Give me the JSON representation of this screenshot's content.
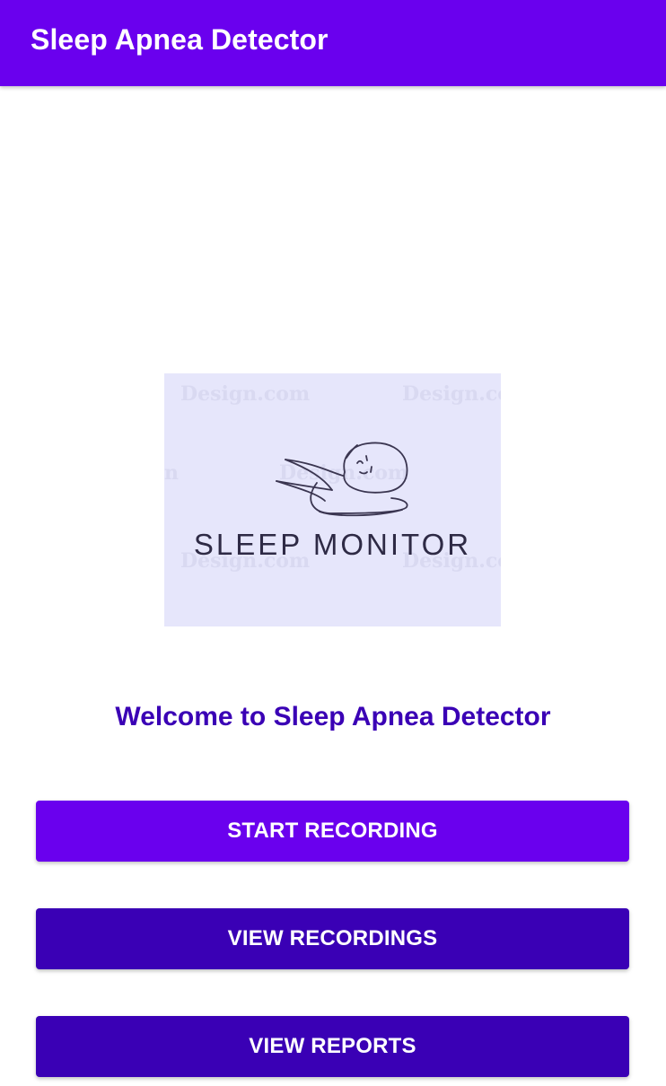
{
  "app_bar": {
    "title": "Sleep Apnea Detector",
    "color": "#6A00EE"
  },
  "logo": {
    "text": "SLEEP MONITOR",
    "icon": "sleeping-person-icon",
    "watermarks": [
      "Design.com",
      "Design.co",
      "n",
      "Design.com",
      "Design.com",
      "Design.co"
    ],
    "background_color": "#E6E6FB"
  },
  "welcome": {
    "text": "Welcome to Sleep Apnea Detector",
    "color": "#3A00B5"
  },
  "buttons": {
    "start_recording": {
      "label": "START RECORDING",
      "color": "#6A00EE"
    },
    "view_recordings": {
      "label": "VIEW RECORDINGS",
      "color": "#3A00B5"
    },
    "view_reports": {
      "label": "VIEW REPORTS",
      "color": "#3A00B5"
    }
  }
}
